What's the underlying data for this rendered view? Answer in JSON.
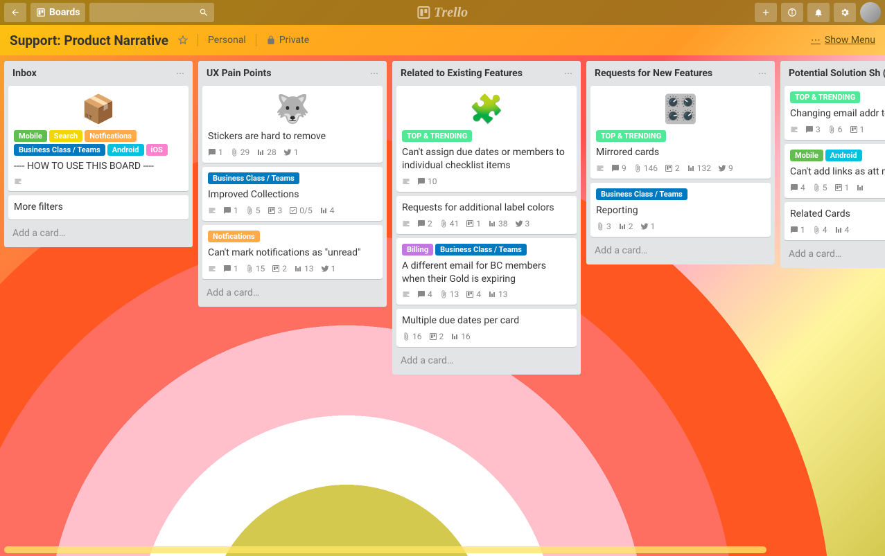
{
  "topbar": {
    "boards_label": "Boards",
    "logo_text": "Trello"
  },
  "board": {
    "title": "Support: Product Narrative",
    "visibility_team": "Personal",
    "visibility_scope": "Private",
    "show_menu": "Show Menu"
  },
  "labels": {
    "mobile": "Mobile",
    "search": "Search",
    "notifications": "Notfications",
    "business_class": "Business Class / Teams",
    "android": "Android",
    "ios": "iOS",
    "top_trending": "TOP & TRENDING",
    "billing": "Billing"
  },
  "lists": [
    {
      "title": "Inbox",
      "add_card": "Add a card…",
      "cards": [
        {
          "cover": "📦",
          "labels": [
            "mobile:green",
            "search:yellow",
            "notifications:orange",
            "business_class:blue",
            "android:sky",
            "ios:pink"
          ],
          "title": "---- HOW TO USE THIS BOARD ----",
          "badges": [
            {
              "type": "desc"
            }
          ]
        },
        {
          "title": "More filters",
          "badges": []
        }
      ]
    },
    {
      "title": "UX Pain Points",
      "add_card": "Add a card…",
      "cards": [
        {
          "cover": "🐺",
          "title": "Stickers are hard to remove",
          "badges": [
            {
              "type": "comment",
              "val": "1"
            },
            {
              "type": "attach",
              "val": "29"
            },
            {
              "type": "vote",
              "val": "28"
            },
            {
              "type": "twitter",
              "val": "1"
            }
          ]
        },
        {
          "labels": [
            "business_class:blue"
          ],
          "title": "Improved Collections",
          "badges": [
            {
              "type": "desc"
            },
            {
              "type": "comment",
              "val": "1"
            },
            {
              "type": "attach",
              "val": "5"
            },
            {
              "type": "trello",
              "val": "3"
            },
            {
              "type": "check",
              "val": "0/5"
            },
            {
              "type": "vote",
              "val": "4"
            }
          ]
        },
        {
          "labels": [
            "notifications:orange"
          ],
          "title": "Can't mark notifications as \"unread\"",
          "badges": [
            {
              "type": "desc"
            },
            {
              "type": "comment",
              "val": "1"
            },
            {
              "type": "attach",
              "val": "15"
            },
            {
              "type": "trello",
              "val": "2"
            },
            {
              "type": "vote",
              "val": "13"
            },
            {
              "type": "twitter",
              "val": "1"
            }
          ]
        }
      ]
    },
    {
      "title": "Related to Existing Features",
      "add_card": "Add a card…",
      "cards": [
        {
          "cover": "🧩",
          "labels": [
            "top_trending:lime"
          ],
          "title": "Can't assign due dates or members to individual checklist items",
          "badges": [
            {
              "type": "desc"
            },
            {
              "type": "comment",
              "val": "10"
            }
          ]
        },
        {
          "title": "Requests for additional label colors",
          "badges": [
            {
              "type": "desc"
            },
            {
              "type": "comment",
              "val": "2"
            },
            {
              "type": "attach",
              "val": "41"
            },
            {
              "type": "trello",
              "val": "1"
            },
            {
              "type": "vote",
              "val": "38"
            },
            {
              "type": "twitter",
              "val": "3"
            }
          ]
        },
        {
          "labels": [
            "billing:purple",
            "business_class:blue"
          ],
          "title": "A different email for BC members when their Gold is expiring",
          "badges": [
            {
              "type": "desc"
            },
            {
              "type": "comment",
              "val": "4"
            },
            {
              "type": "attach",
              "val": "13"
            },
            {
              "type": "trello",
              "val": "4"
            },
            {
              "type": "vote",
              "val": "13"
            }
          ]
        },
        {
          "title": "Multiple due dates per card",
          "badges": [
            {
              "type": "attach",
              "val": "16"
            },
            {
              "type": "trello",
              "val": "2"
            },
            {
              "type": "vote",
              "val": "16"
            }
          ]
        }
      ]
    },
    {
      "title": "Requests for New Features",
      "add_card": "Add a card…",
      "cards": [
        {
          "cover": "🎛️",
          "labels": [
            "top_trending:lime"
          ],
          "title": "Mirrored cards",
          "badges": [
            {
              "type": "desc"
            },
            {
              "type": "comment",
              "val": "9"
            },
            {
              "type": "attach",
              "val": "146"
            },
            {
              "type": "trello",
              "val": "2"
            },
            {
              "type": "vote",
              "val": "132"
            },
            {
              "type": "twitter",
              "val": "9"
            }
          ]
        },
        {
          "labels": [
            "business_class:blue"
          ],
          "title": "Reporting",
          "badges": [
            {
              "type": "attach",
              "val": "3"
            },
            {
              "type": "vote",
              "val": "2"
            },
            {
              "type": "twitter",
              "val": "1"
            }
          ]
        }
      ]
    },
    {
      "title": "Potential Solution Sh (Monitor)",
      "add_card": "Add a card…",
      "cards": [
        {
          "labels": [
            "top_trending:lime"
          ],
          "title": "Changing email addr to users",
          "badges": [
            {
              "type": "desc"
            },
            {
              "type": "comment",
              "val": "3"
            },
            {
              "type": "attach",
              "val": "6"
            },
            {
              "type": "trello",
              "val": "1"
            }
          ]
        },
        {
          "labels": [
            "mobile:green",
            "android:sky"
          ],
          "title": "Can't add links as att mobile apps",
          "badges": [
            {
              "type": "comment",
              "val": "4"
            },
            {
              "type": "attach",
              "val": "5"
            },
            {
              "type": "trello",
              "val": "1"
            },
            {
              "type": "vote",
              "val": ""
            }
          ]
        },
        {
          "title": "Related Cards",
          "badges": [
            {
              "type": "comment",
              "val": "1"
            },
            {
              "type": "attach",
              "val": "4"
            },
            {
              "type": "vote",
              "val": "4"
            }
          ]
        }
      ]
    }
  ]
}
